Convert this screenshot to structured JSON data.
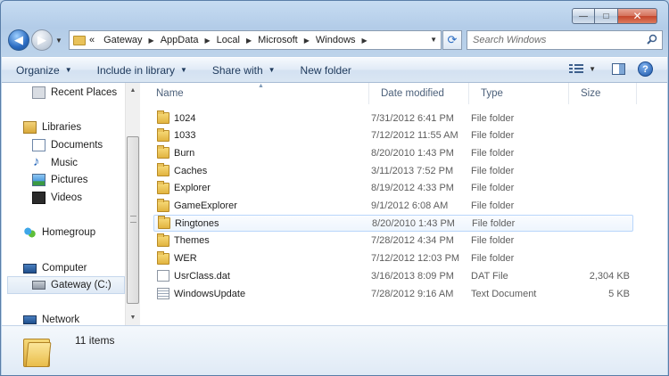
{
  "window": {
    "caption": {
      "minimize": "—",
      "maximize": "□",
      "close": "✕"
    }
  },
  "nav": {
    "back_glyph": "◀",
    "forward_glyph": "▶",
    "address": {
      "overflow": "«",
      "crumbs": [
        "Gateway",
        "AppData",
        "Local",
        "Microsoft",
        "Windows"
      ]
    },
    "refresh_glyph": "⟳",
    "search": {
      "placeholder": "Search Windows"
    }
  },
  "toolbar": {
    "organize": "Organize",
    "include_in_library": "Include in library",
    "share_with": "Share with",
    "new_folder": "New folder",
    "help_glyph": "?"
  },
  "sidebar": {
    "items": [
      {
        "label": "Recent Places",
        "icon": "recent-places-icon"
      },
      {
        "label": "Libraries",
        "icon": "libraries-icon"
      },
      {
        "label": "Documents",
        "icon": "documents-icon"
      },
      {
        "label": "Music",
        "icon": "music-icon"
      },
      {
        "label": "Pictures",
        "icon": "pictures-icon"
      },
      {
        "label": "Videos",
        "icon": "videos-icon"
      },
      {
        "label": "Homegroup",
        "icon": "homegroup-icon"
      },
      {
        "label": "Computer",
        "icon": "computer-icon"
      },
      {
        "label": "Gateway (C:)",
        "icon": "drive-icon"
      },
      {
        "label": "Network",
        "icon": "network-icon"
      }
    ]
  },
  "filelist": {
    "columns": {
      "name": "Name",
      "date": "Date modified",
      "type": "Type",
      "size": "Size"
    },
    "rows": [
      {
        "name": "1024",
        "date": "7/31/2012 6:41 PM",
        "type": "File folder",
        "size": "",
        "icon": "folder-icon"
      },
      {
        "name": "1033",
        "date": "7/12/2012 11:55 AM",
        "type": "File folder",
        "size": "",
        "icon": "folder-icon"
      },
      {
        "name": "Burn",
        "date": "8/20/2010 1:43 PM",
        "type": "File folder",
        "size": "",
        "icon": "folder-icon"
      },
      {
        "name": "Caches",
        "date": "3/11/2013 7:52 PM",
        "type": "File folder",
        "size": "",
        "icon": "folder-icon"
      },
      {
        "name": "Explorer",
        "date": "8/19/2012 4:33 PM",
        "type": "File folder",
        "size": "",
        "icon": "folder-icon"
      },
      {
        "name": "GameExplorer",
        "date": "9/1/2012 6:08 AM",
        "type": "File folder",
        "size": "",
        "icon": "folder-icon"
      },
      {
        "name": "Ringtones",
        "date": "8/20/2010 1:43 PM",
        "type": "File folder",
        "size": "",
        "icon": "folder-icon"
      },
      {
        "name": "Themes",
        "date": "7/28/2012 4:34 PM",
        "type": "File folder",
        "size": "",
        "icon": "folder-icon"
      },
      {
        "name": "WER",
        "date": "7/12/2012 12:03 PM",
        "type": "File folder",
        "size": "",
        "icon": "folder-icon"
      },
      {
        "name": "UsrClass.dat",
        "date": "3/16/2013 8:09 PM",
        "type": "DAT File",
        "size": "2,304 KB",
        "icon": "dat-file-icon"
      },
      {
        "name": "WindowsUpdate",
        "date": "7/28/2012 9:16 AM",
        "type": "Text Document",
        "size": "5 KB",
        "icon": "text-document-icon"
      }
    ]
  },
  "details": {
    "count": "11 items"
  }
}
